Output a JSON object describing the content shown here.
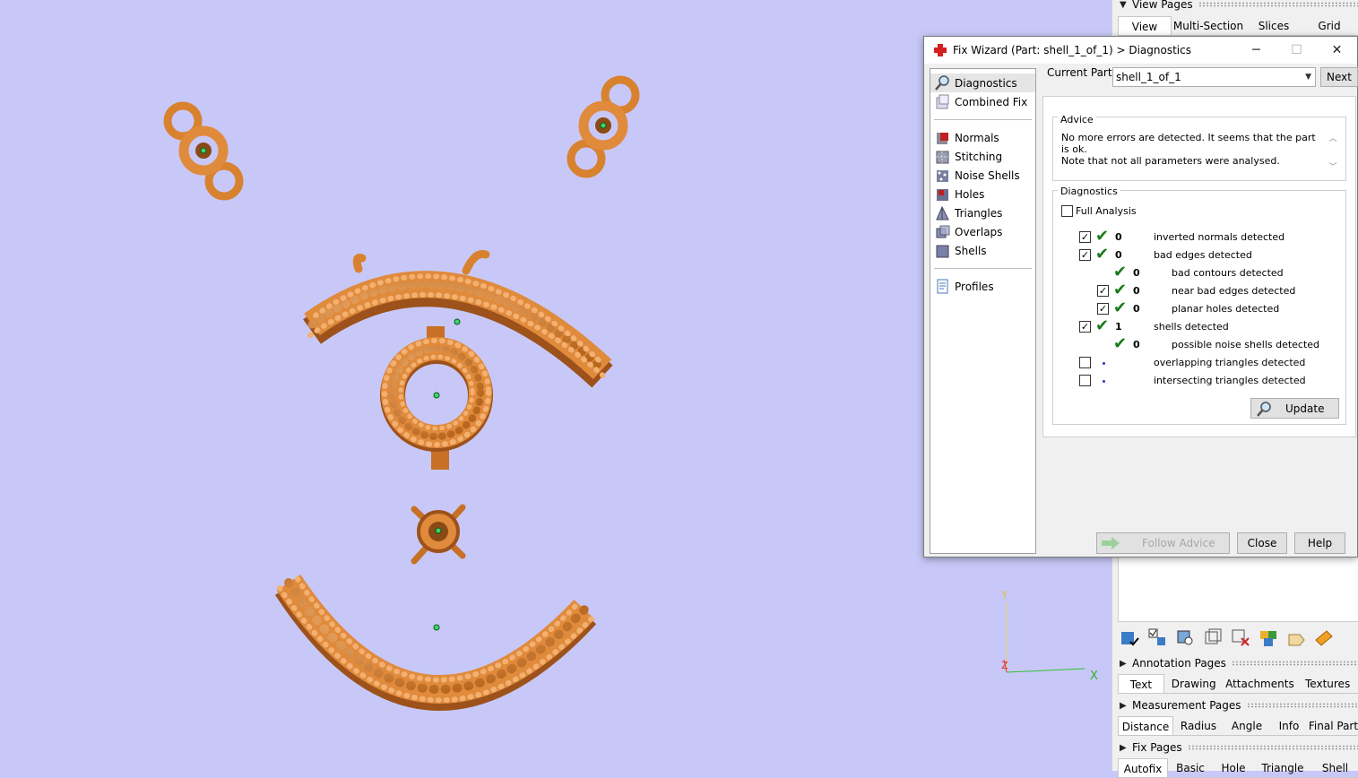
{
  "viewport": {
    "background": "#c8c8f8"
  },
  "axes_gizmo": {
    "y": "Y",
    "x": "X",
    "z": "Z"
  },
  "right_panel": {
    "view_pages": {
      "title": "View Pages",
      "tabs": [
        "View",
        "Multi-Section",
        "Slices",
        "Grid"
      ],
      "active": "View"
    },
    "annotation_pages": {
      "title": "Annotation Pages",
      "tabs": [
        "Text",
        "Drawing",
        "Attachments",
        "Textures"
      ],
      "active": "Text"
    },
    "measurement_pages": {
      "title": "Measurement Pages",
      "tabs": [
        "Distance",
        "Radius",
        "Angle",
        "Info",
        "Final Part"
      ],
      "active": "Distance"
    },
    "fix_pages": {
      "title": "Fix Pages",
      "tabs": [
        "Autofix",
        "Basic",
        "Hole",
        "Triangle",
        "Shell"
      ],
      "active": "Autofix"
    }
  },
  "dialog": {
    "title": "Fix Wizard (Part: shell_1_of_1) > Diagnostics",
    "window_buttons": {
      "minimize": "─",
      "maximize": "☐",
      "close": "✕"
    },
    "nav": {
      "group1": [
        {
          "label": "Diagnostics",
          "icon": "magnifier-icon",
          "selected": true
        },
        {
          "label": "Combined Fix",
          "icon": "combined-fix-icon"
        }
      ],
      "group2": [
        {
          "label": "Normals",
          "icon": "normals-icon"
        },
        {
          "label": "Stitching",
          "icon": "stitching-icon"
        },
        {
          "label": "Noise Shells",
          "icon": "noise-shells-icon"
        },
        {
          "label": "Holes",
          "icon": "holes-icon"
        },
        {
          "label": "Triangles",
          "icon": "triangles-icon"
        },
        {
          "label": "Overlaps",
          "icon": "overlaps-icon"
        },
        {
          "label": "Shells",
          "icon": "shells-icon"
        }
      ],
      "group3": [
        {
          "label": "Profiles",
          "icon": "profiles-icon"
        }
      ]
    },
    "current_part_label": "Current Part:",
    "current_part_value": "shell_1_of_1",
    "next_label": "Next",
    "advice_title": "Advice",
    "advice_text_1": "No more errors are detected. It seems that the part is ok.",
    "advice_text_2": "Note that not all parameters were analysed.",
    "diagnostics_title": "Diagnostics",
    "full_analysis_label": "Full Analysis",
    "rows": [
      {
        "checkbox": true,
        "checked": true,
        "status": "ok",
        "count": "0",
        "label": "inverted normals detected",
        "indent": 0
      },
      {
        "checkbox": true,
        "checked": true,
        "status": "ok",
        "count": "0",
        "label": "bad edges detected",
        "indent": 0
      },
      {
        "checkbox": false,
        "checked": false,
        "status": "ok",
        "count": "0",
        "label": "bad contours detected",
        "indent": 1
      },
      {
        "checkbox": true,
        "checked": true,
        "status": "ok",
        "count": "0",
        "label": "near bad edges detected",
        "indent": 1
      },
      {
        "checkbox": true,
        "checked": true,
        "status": "ok",
        "count": "0",
        "label": "planar holes detected",
        "indent": 1
      },
      {
        "checkbox": true,
        "checked": true,
        "status": "ok",
        "count": "1",
        "label": "shells detected",
        "indent": 0
      },
      {
        "checkbox": false,
        "checked": false,
        "status": "ok",
        "count": "0",
        "label": "possible noise shells detected",
        "indent": 1
      },
      {
        "checkbox": true,
        "checked": false,
        "status": "none",
        "count": "",
        "label": "overlapping triangles detected",
        "indent": 0
      },
      {
        "checkbox": true,
        "checked": false,
        "status": "none",
        "count": "",
        "label": "intersecting triangles detected",
        "indent": 0
      }
    ],
    "update_label": "Update",
    "follow_advice_label": "Follow Advice",
    "close_label": "Close",
    "help_label": "Help"
  },
  "colors": {
    "part": "#e08a3c",
    "part_dark": "#a2561a",
    "check": "#1a7a1a",
    "title_icon": "#d32020"
  }
}
